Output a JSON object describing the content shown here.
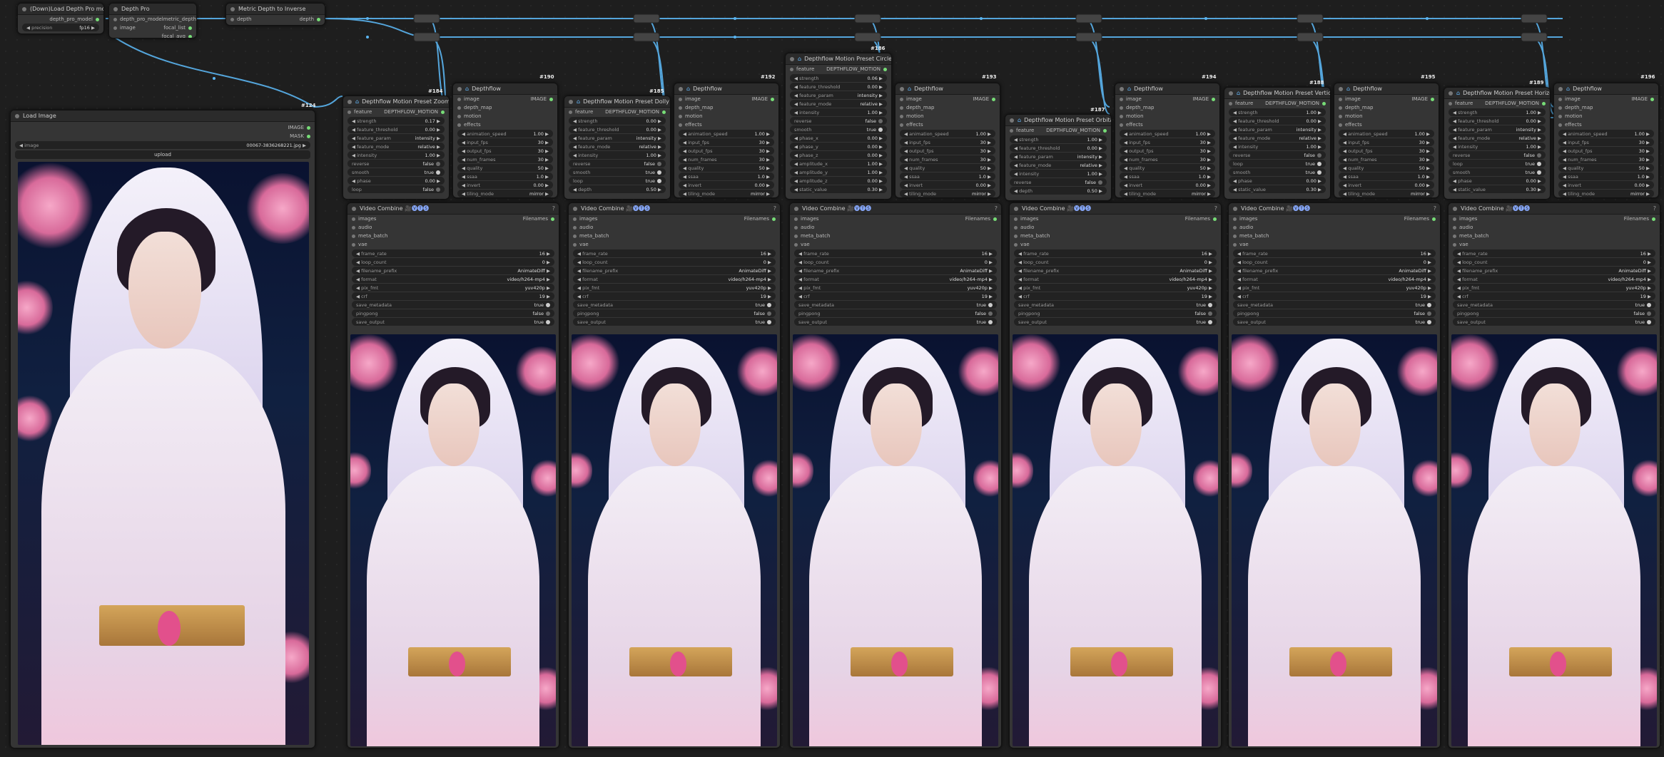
{
  "nodes": {
    "dl_depth_pro": {
      "title": "(Down)Load Depth Pro model",
      "output": "depth_pro_model",
      "precision_label": "precision",
      "precision": "fp16"
    },
    "depth_pro": {
      "title": "Depth Pro",
      "in_model": "depth_pro_model",
      "in_image": "image",
      "out_metric": "metric_depth",
      "out_focal_list": "focal_list",
      "out_focal_avg": "focal_avg"
    },
    "metric_inverse": {
      "title": "Metric Depth to Inverse",
      "in_depth": "depth",
      "out_depth": "depth"
    },
    "load_image": {
      "title": "Load Image",
      "id": "#124",
      "out_image": "IMAGE",
      "out_mask": "MASK",
      "image_label": "image",
      "image_value": "00067-3836268221.jpg",
      "upload": "upload"
    }
  },
  "labels": {
    "feature": "feature",
    "depthflow_motion": "DEPTHFLOW_MOTION",
    "image_in": "image",
    "depth_map": "depth_map",
    "motion": "motion",
    "effects": "effects",
    "image_out": "IMAGE",
    "images": "images",
    "audio": "audio",
    "meta_batch": "meta_batch",
    "vae": "vae",
    "filenames": "Filenames",
    "depthflow": "Depthflow",
    "video_combine": "Video Combine",
    "vc_icons": "🎥🅥🅣🅢",
    "depthflow_tag": "⌂",
    "help": "?"
  },
  "presets": [
    {
      "id": "#184",
      "title": "Depthflow Motion Preset Zoom",
      "rows": [
        [
          "strength",
          "0.17"
        ],
        [
          "feature_threshold",
          "0.00"
        ],
        [
          "feature_param",
          "intensity"
        ],
        [
          "feature_mode",
          "relative"
        ],
        [
          "intensity",
          "1.00"
        ],
        [
          "reverse",
          "false"
        ],
        [
          "smooth",
          "true"
        ],
        [
          "phase",
          "0.00"
        ],
        [
          "loop",
          "false"
        ]
      ]
    },
    {
      "id": "#185",
      "title": "Depthflow Motion Preset Dolly",
      "rows": [
        [
          "strength",
          "0.00"
        ],
        [
          "feature_threshold",
          "0.00"
        ],
        [
          "feature_param",
          "intensity"
        ],
        [
          "feature_mode",
          "relative"
        ],
        [
          "intensity",
          "1.00"
        ],
        [
          "reverse",
          "false"
        ],
        [
          "smooth",
          "true"
        ],
        [
          "loop",
          "true"
        ],
        [
          "depth",
          "0.50"
        ]
      ]
    },
    {
      "id": "#186",
      "title": "Depthflow Motion Preset Circle",
      "rows": [
        [
          "strength",
          "0.06"
        ],
        [
          "feature_threshold",
          "0.00"
        ],
        [
          "feature_param",
          "intensity"
        ],
        [
          "feature_mode",
          "relative"
        ],
        [
          "intensity",
          "1.00"
        ],
        [
          "reverse",
          "false"
        ],
        [
          "smooth",
          "true"
        ],
        [
          "phase_x",
          "0.00"
        ],
        [
          "phase_y",
          "0.00"
        ],
        [
          "phase_z",
          "0.00"
        ],
        [
          "amplitude_x",
          "1.00"
        ],
        [
          "amplitude_y",
          "1.00"
        ],
        [
          "amplitude_z",
          "0.00"
        ],
        [
          "static_value",
          "0.30"
        ]
      ]
    },
    {
      "id": "#187",
      "title": "Depthflow Motion Preset Orbital",
      "rows": [
        [
          "strength",
          "1.00"
        ],
        [
          "feature_threshold",
          "0.00"
        ],
        [
          "feature_param",
          "intensity"
        ],
        [
          "feature_mode",
          "relative"
        ],
        [
          "intensity",
          "1.00"
        ],
        [
          "reverse",
          "false"
        ],
        [
          "depth",
          "0.50"
        ]
      ]
    },
    {
      "id": "#188",
      "title": "Depthflow Motion Preset Vertical",
      "rows": [
        [
          "strength",
          "1.00"
        ],
        [
          "feature_threshold",
          "0.00"
        ],
        [
          "feature_param",
          "intensity"
        ],
        [
          "feature_mode",
          "relative"
        ],
        [
          "intensity",
          "1.00"
        ],
        [
          "reverse",
          "false"
        ],
        [
          "loop",
          "true"
        ],
        [
          "smooth",
          "true"
        ],
        [
          "phase",
          "0.00"
        ],
        [
          "static_value",
          "0.30"
        ]
      ]
    },
    {
      "id": "#189",
      "title": "Depthflow Motion Preset Horizontal",
      "rows": [
        [
          "strength",
          "1.00"
        ],
        [
          "feature_threshold",
          "0.00"
        ],
        [
          "feature_param",
          "intensity"
        ],
        [
          "feature_mode",
          "relative"
        ],
        [
          "intensity",
          "1.00"
        ],
        [
          "reverse",
          "false"
        ],
        [
          "loop",
          "true"
        ],
        [
          "smooth",
          "true"
        ],
        [
          "phase",
          "0.00"
        ],
        [
          "static_value",
          "0.30"
        ]
      ]
    }
  ],
  "depthflows": [
    {
      "id": "#190",
      "rows": [
        [
          "animation_speed",
          "1.00"
        ],
        [
          "input_fps",
          "30"
        ],
        [
          "output_fps",
          "30"
        ],
        [
          "num_frames",
          "30"
        ],
        [
          "quality",
          "50"
        ],
        [
          "ssaa",
          "1.0"
        ],
        [
          "invert",
          "0.00"
        ],
        [
          "tiling_mode",
          "mirror"
        ]
      ]
    },
    {
      "id": "#192",
      "rows": [
        [
          "animation_speed",
          "1.00"
        ],
        [
          "input_fps",
          "30"
        ],
        [
          "output_fps",
          "30"
        ],
        [
          "num_frames",
          "30"
        ],
        [
          "quality",
          "50"
        ],
        [
          "ssaa",
          "1.0"
        ],
        [
          "invert",
          "0.00"
        ],
        [
          "tiling_mode",
          "mirror"
        ]
      ]
    },
    {
      "id": "#193",
      "rows": [
        [
          "animation_speed",
          "1.00"
        ],
        [
          "input_fps",
          "30"
        ],
        [
          "output_fps",
          "30"
        ],
        [
          "num_frames",
          "30"
        ],
        [
          "quality",
          "50"
        ],
        [
          "ssaa",
          "1.0"
        ],
        [
          "invert",
          "0.00"
        ],
        [
          "tiling_mode",
          "mirror"
        ]
      ]
    },
    {
      "id": "#194",
      "rows": [
        [
          "animation_speed",
          "1.00"
        ],
        [
          "input_fps",
          "30"
        ],
        [
          "output_fps",
          "30"
        ],
        [
          "num_frames",
          "30"
        ],
        [
          "quality",
          "50"
        ],
        [
          "ssaa",
          "1.0"
        ],
        [
          "invert",
          "0.00"
        ],
        [
          "tiling_mode",
          "mirror"
        ]
      ]
    },
    {
      "id": "#195",
      "rows": [
        [
          "animation_speed",
          "1.00"
        ],
        [
          "input_fps",
          "30"
        ],
        [
          "output_fps",
          "30"
        ],
        [
          "num_frames",
          "30"
        ],
        [
          "quality",
          "50"
        ],
        [
          "ssaa",
          "1.0"
        ],
        [
          "invert",
          "0.00"
        ],
        [
          "tiling_mode",
          "mirror"
        ]
      ]
    },
    {
      "id": "#196",
      "rows": [
        [
          "animation_speed",
          "1.00"
        ],
        [
          "input_fps",
          "30"
        ],
        [
          "output_fps",
          "30"
        ],
        [
          "num_frames",
          "30"
        ],
        [
          "quality",
          "50"
        ],
        [
          "ssaa",
          "1.0"
        ],
        [
          "invert",
          "0.00"
        ],
        [
          "tiling_mode",
          "mirror"
        ]
      ]
    }
  ],
  "video_combines": [
    {
      "rows": [
        [
          "frame_rate",
          "16"
        ],
        [
          "loop_count",
          "0"
        ],
        [
          "filename_prefix",
          "AnimateDiff"
        ],
        [
          "format",
          "video/h264-mp4"
        ],
        [
          "pix_fmt",
          "yuv420p"
        ],
        [
          "crf",
          "19"
        ],
        [
          "save_metadata",
          "true"
        ],
        [
          "pingpong",
          "false"
        ],
        [
          "save_output",
          "true"
        ]
      ]
    },
    {
      "rows": [
        [
          "frame_rate",
          "16"
        ],
        [
          "loop_count",
          "0"
        ],
        [
          "filename_prefix",
          "AnimateDiff"
        ],
        [
          "format",
          "video/h264-mp4"
        ],
        [
          "pix_fmt",
          "yuv420p"
        ],
        [
          "crf",
          "19"
        ],
        [
          "save_metadata",
          "true"
        ],
        [
          "pingpong",
          "false"
        ],
        [
          "save_output",
          "true"
        ]
      ]
    },
    {
      "rows": [
        [
          "frame_rate",
          "16"
        ],
        [
          "loop_count",
          "0"
        ],
        [
          "filename_prefix",
          "AnimateDiff"
        ],
        [
          "format",
          "video/h264-mp4"
        ],
        [
          "pix_fmt",
          "yuv420p"
        ],
        [
          "crf",
          "19"
        ],
        [
          "save_metadata",
          "true"
        ],
        [
          "pingpong",
          "false"
        ],
        [
          "save_output",
          "true"
        ]
      ]
    },
    {
      "rows": [
        [
          "frame_rate",
          "16"
        ],
        [
          "loop_count",
          "0"
        ],
        [
          "filename_prefix",
          "AnimateDiff"
        ],
        [
          "format",
          "video/h264-mp4"
        ],
        [
          "pix_fmt",
          "yuv420p"
        ],
        [
          "crf",
          "19"
        ],
        [
          "save_metadata",
          "true"
        ],
        [
          "pingpong",
          "false"
        ],
        [
          "save_output",
          "true"
        ]
      ]
    },
    {
      "rows": [
        [
          "frame_rate",
          "16"
        ],
        [
          "loop_count",
          "0"
        ],
        [
          "filename_prefix",
          "AnimateDiff"
        ],
        [
          "format",
          "video/h264-mp4"
        ],
        [
          "pix_fmt",
          "yuv420p"
        ],
        [
          "crf",
          "19"
        ],
        [
          "save_metadata",
          "true"
        ],
        [
          "pingpong",
          "false"
        ],
        [
          "save_output",
          "true"
        ]
      ]
    },
    {
      "rows": [
        [
          "frame_rate",
          "16"
        ],
        [
          "loop_count",
          "0"
        ],
        [
          "filename_prefix",
          "AnimateDiff"
        ],
        [
          "format",
          "video/h264-mp4"
        ],
        [
          "pix_fmt",
          "yuv420p"
        ],
        [
          "crf",
          "19"
        ],
        [
          "save_metadata",
          "true"
        ],
        [
          "pingpong",
          "false"
        ],
        [
          "save_output",
          "true"
        ]
      ]
    }
  ],
  "colors": {
    "wire": "#5ab4f0",
    "background": "#1e1e1e",
    "node": "#353535",
    "title": "#2b2b2b",
    "blossom": "#f6a8c8",
    "belt": "#d4a55a"
  },
  "icons": {
    "node_dot": "circle-icon",
    "depthflow": "depthflow-icon",
    "video": "video-icon"
  }
}
